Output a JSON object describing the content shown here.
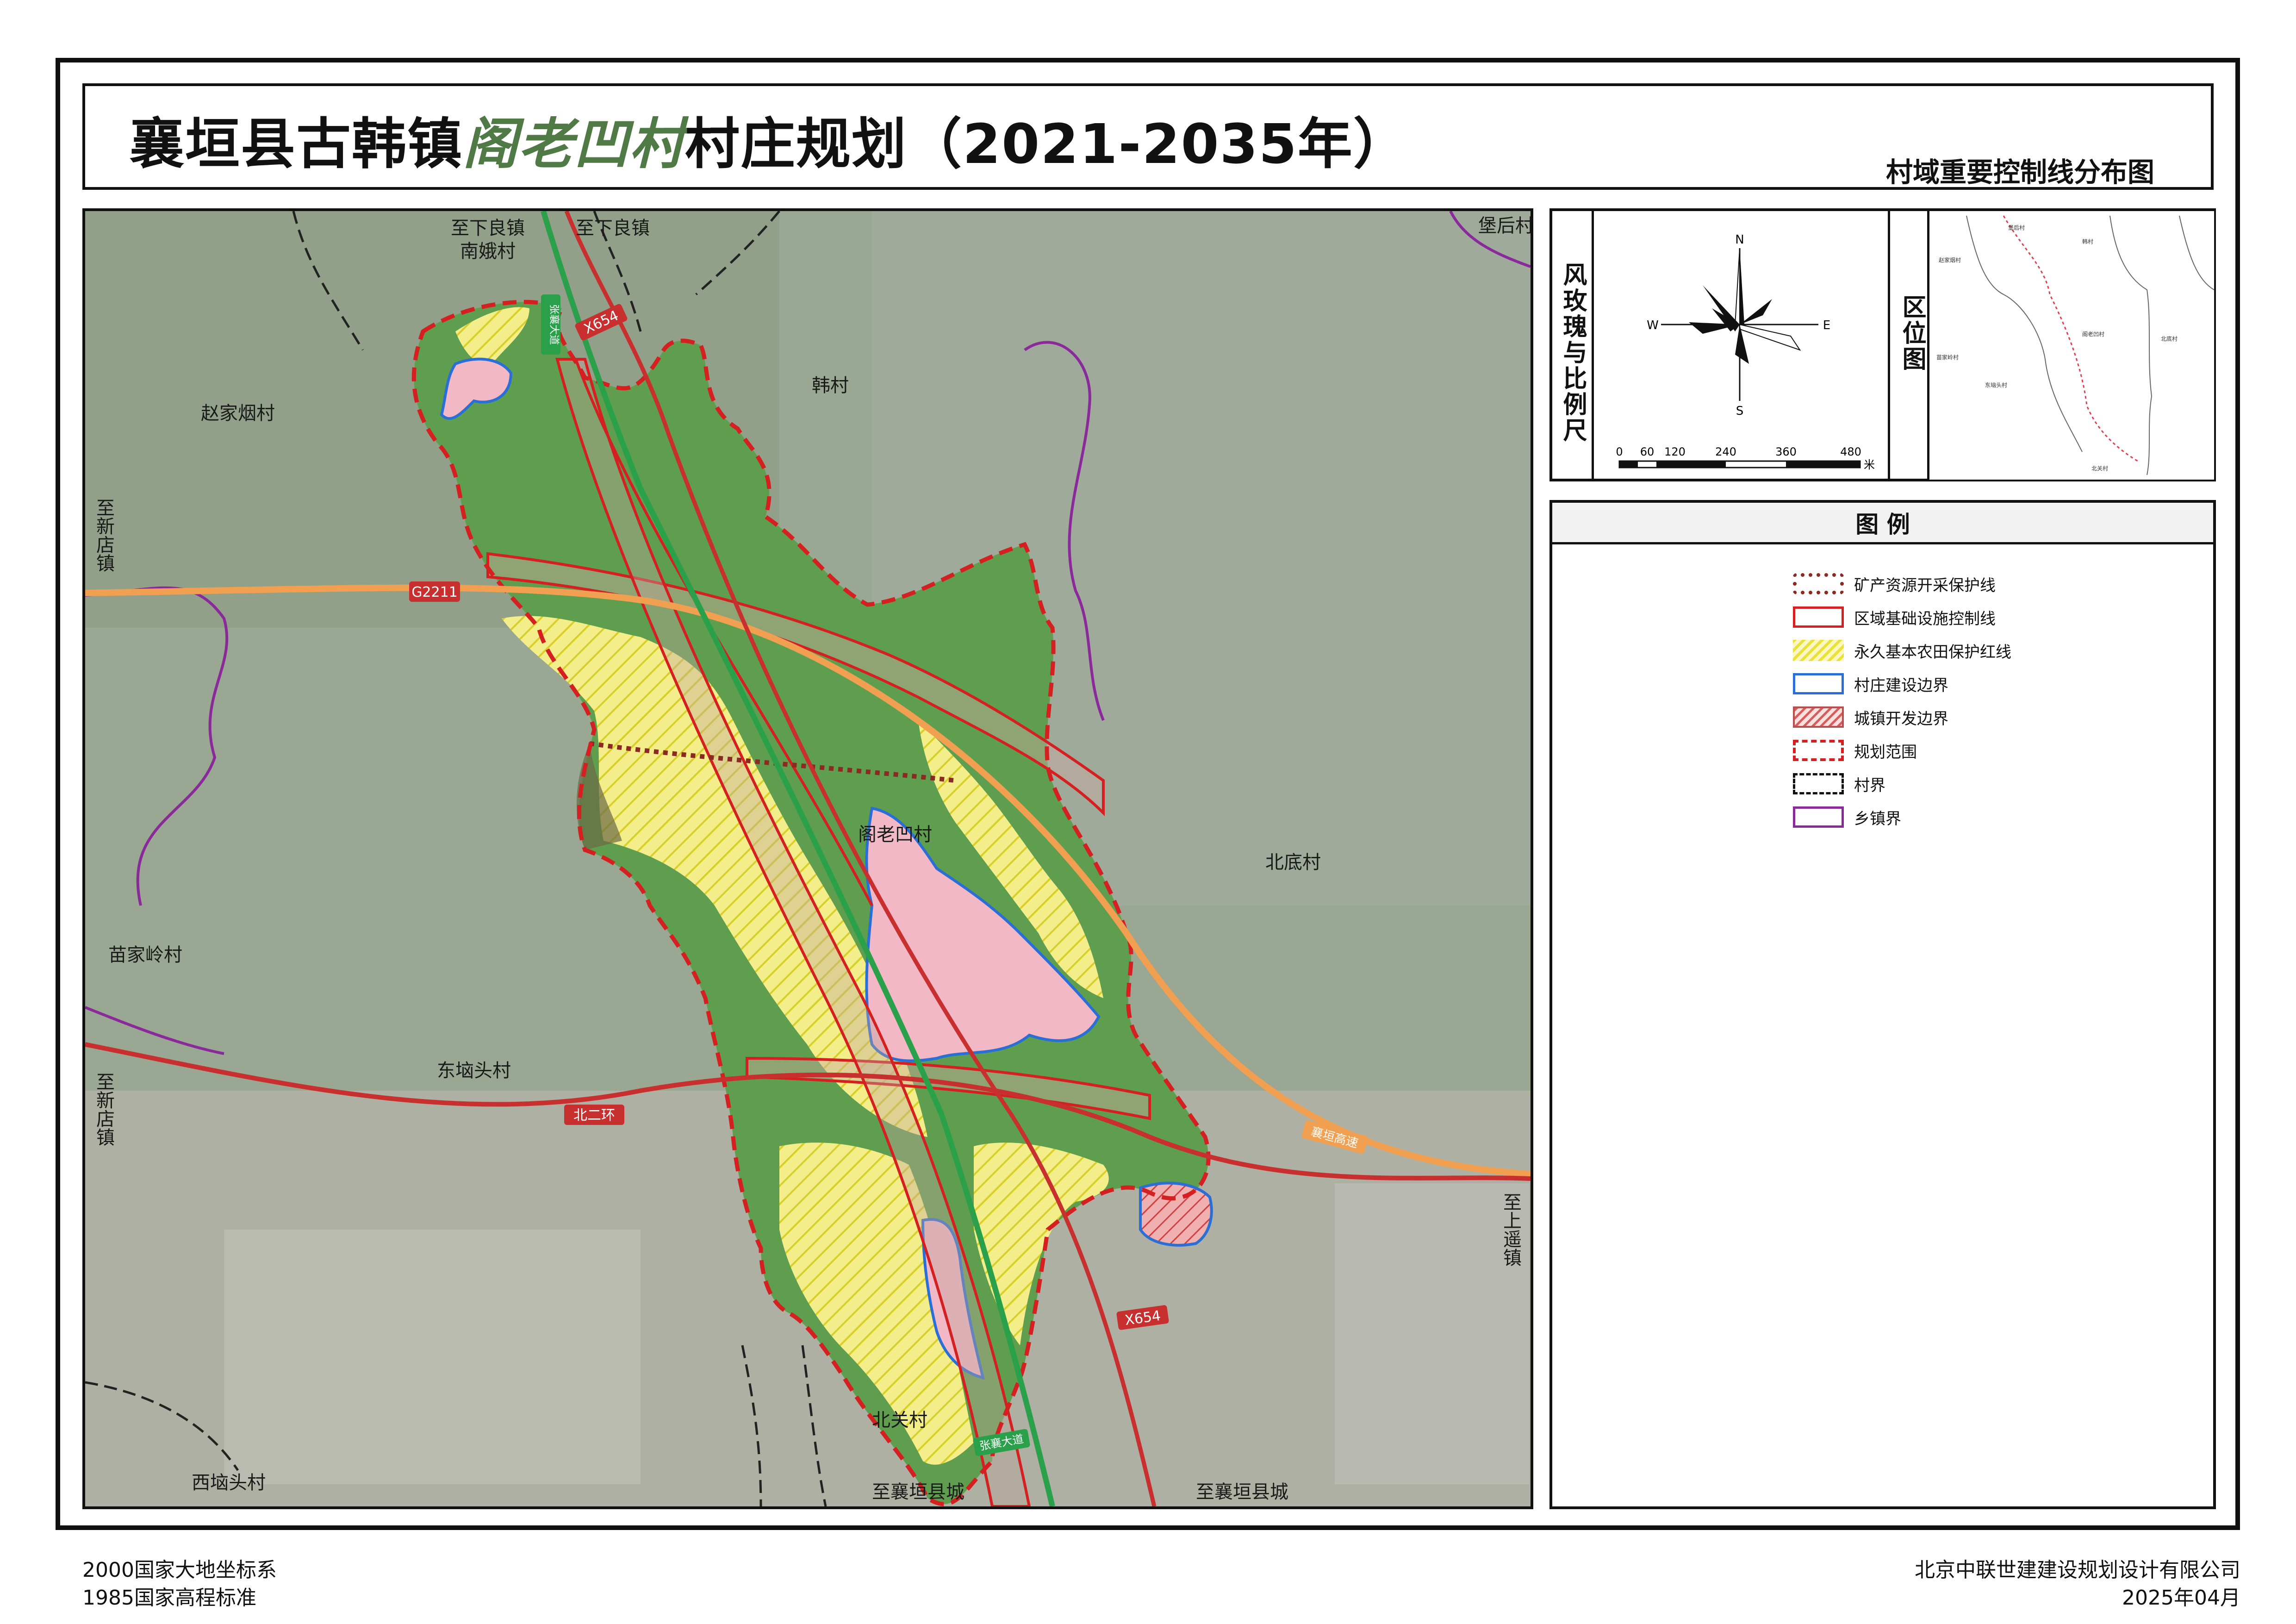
{
  "title": {
    "prefix": "襄垣县古韩镇",
    "village": "阁老凹村",
    "suffix": "村庄规划（2021-2035年）"
  },
  "subtitle": "村域重要控制线分布图",
  "compass": {
    "panel_title": "风玫瑰与比例尺",
    "n": "N",
    "s": "S",
    "e": "E",
    "w": "W",
    "scale_ticks": [
      "0",
      "60",
      "120",
      "240",
      "360",
      "480"
    ],
    "scale_unit": "米"
  },
  "location": {
    "panel_title": "区位图",
    "labels": [
      "堡后村",
      "韩村",
      "赵家烟村",
      "阁老凹村",
      "北底村",
      "苗家岭村",
      "东垴头村",
      "北关村"
    ]
  },
  "legend": {
    "title": "图  例",
    "items": [
      {
        "label": "矿产资源开采保护线",
        "color": "#8b2a22"
      },
      {
        "label": "区域基础设施控制线",
        "color": "#d42020"
      },
      {
        "label": "永久基本农田保护红线",
        "color": "#e8e23a"
      },
      {
        "label": "村庄建设边界",
        "color": "#2a6fd6"
      },
      {
        "label": "城镇开发边界",
        "color": "#d85c5c"
      },
      {
        "label": "规划范围",
        "color": "#d42020"
      },
      {
        "label": "村界",
        "color": "#111111"
      },
      {
        "label": "乡镇界",
        "color": "#8a2a9a"
      }
    ]
  },
  "map_labels": {
    "villages": [
      "南娥村",
      "韩村",
      "赵家烟村",
      "阁老凹村",
      "北底村",
      "苗家岭村",
      "东垴头村",
      "北关村",
      "西垴头村",
      "堡后村"
    ],
    "directions": [
      "至下良镇",
      "至下良镇",
      "至新店镇",
      "至新店镇",
      "至上遥镇",
      "至襄垣县城",
      "至襄垣县城"
    ],
    "roads": [
      "X654",
      "G2211",
      "北二环",
      "X654",
      "张襄大道",
      "张襄大道",
      "襄垣高速"
    ]
  },
  "footer": {
    "coord_system": "2000国家大地坐标系",
    "elevation": "1985国家高程标准",
    "company": "北京中联世建建设规划设计有限公司",
    "date": "2025年04月"
  },
  "colors": {
    "forest": "#5f9e4f",
    "farmland": "#efe66a",
    "village_build": "#f2b8c6",
    "planning_boundary": "#d42020",
    "township_boundary": "#8a2a9a",
    "expressway": "#f0a050"
  }
}
